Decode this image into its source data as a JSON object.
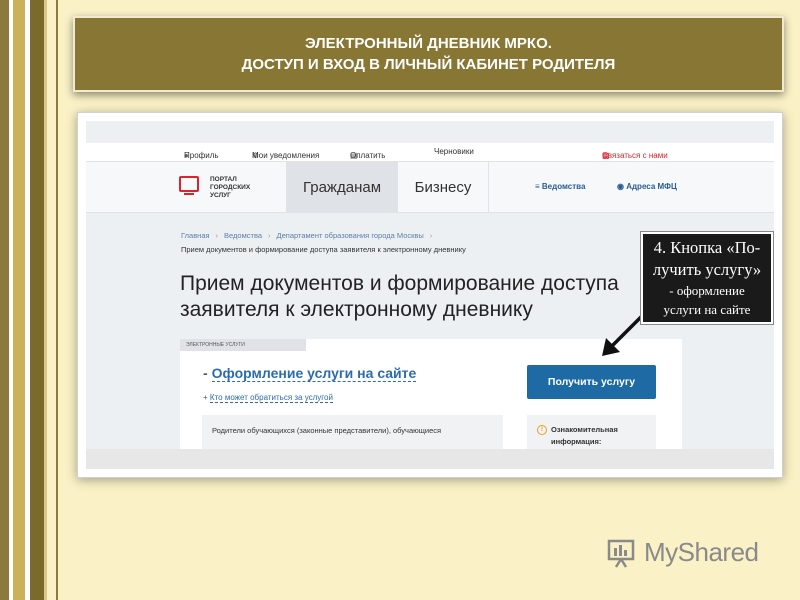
{
  "banner": {
    "line1": "ЭЛЕКТРОННЫЙ ДНЕВНИК МРКО.",
    "line2": "ДОСТУП И ВХОД В ЛИЧНЫЙ КАБИНЕТ РОДИТЕЛЯ"
  },
  "portal": {
    "topbar": {
      "profile": "Профиль",
      "notifications": "Мои уведомления",
      "pay": "Оплатить",
      "drafts": "Черновики",
      "contact": "Связаться с нами"
    },
    "logo": {
      "line1": "ПОРТАЛ",
      "line2": "ГОРОДСКИХ",
      "line3": "УСЛУГ"
    },
    "tabs": {
      "citizens": "Гражданам",
      "business": "Бизнесу"
    },
    "header_links": {
      "departments": "Ведомства",
      "mfc": "Адреса МФЦ"
    },
    "breadcrumbs": [
      "Главная",
      "Ведомства",
      "Департамент образования города Москвы"
    ],
    "breadcrumb_current": "Прием документов и формирование доступа заявителя к электронному дневнику",
    "page_title": "Прием документов и формирование доступа заявителя к электронному дневнику",
    "card_tag": "ЭЛЕКТРОННЫЕ УСЛУГИ",
    "service_title": "Оформление услуги на сайте",
    "service_link": "Кто может обратиться за услугой",
    "get_service_button": "Получить услугу",
    "applicants_text": "Родители обучающихся (законные представители), обучающиеся",
    "info_label": "Ознакомительная информация:"
  },
  "callout": {
    "line1": "4. Кнопка «По-",
    "line2": "лучить услугу»",
    "line3": "- оформление",
    "line4": "услуги на сайте"
  },
  "watermark": {
    "text": "MyShared"
  }
}
